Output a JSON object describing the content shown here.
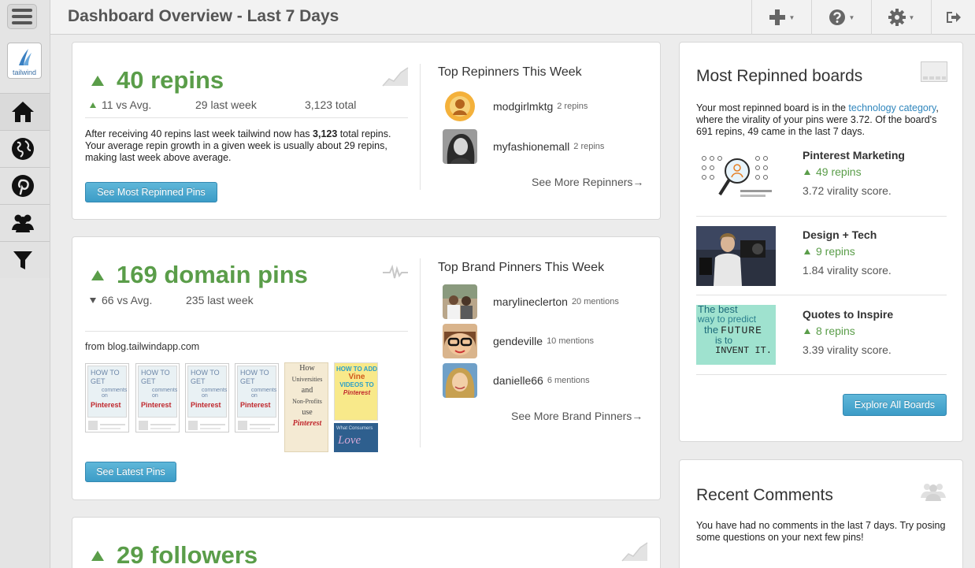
{
  "header": {
    "title": "Dashboard Overview - Last 7 Days"
  },
  "sidebar": {
    "logo_text": "tailwind",
    "items": [
      {
        "icon": "home-icon"
      },
      {
        "icon": "globe-icon"
      },
      {
        "icon": "pinterest-icon"
      },
      {
        "icon": "users-icon"
      },
      {
        "icon": "filter-icon"
      }
    ]
  },
  "repins_card": {
    "metric": "40 repins",
    "vs_avg": "11 vs Avg.",
    "last_week": "29 last week",
    "total": "3,123 total",
    "desc_pre": "After receiving 40 repins last week tailwind now has ",
    "desc_bold": "3,123",
    "desc_post": " total repins. Your average repin growth in a given week is usually about 29 repins, making last week above average.",
    "button": "See Most Repinned Pins",
    "top_title": "Top Repinners This Week",
    "top": [
      {
        "name": "modgirlmktg",
        "sub": "2 repins"
      },
      {
        "name": "myfashionemall",
        "sub": "2 repins"
      }
    ],
    "see_more": "See More Repinners→"
  },
  "domain_card": {
    "metric": "169 domain pins",
    "vs_avg": "66 vs Avg.",
    "last_week": "235 last week",
    "from": "from blog.tailwindapp.com",
    "pin_title_1": "HOW TO",
    "pin_title_2": "GET",
    "pin_title_3": "comments on",
    "pin_brand": "Pinterest",
    "pin5_lines": [
      "How",
      "Universities",
      "and",
      "Non-Profits",
      "use",
      "Pinterest"
    ],
    "pin6_lines": [
      "HOW TO ADD",
      "Vine",
      "VIDEOS TO",
      "Pinterest"
    ],
    "pin7_lines": [
      "What Consumers",
      "Love"
    ],
    "button": "See Latest Pins",
    "top_title": "Top Brand Pinners This Week",
    "top": [
      {
        "name": "marylineclerton",
        "sub": "20 mentions"
      },
      {
        "name": "gendeville",
        "sub": "10 mentions"
      },
      {
        "name": "danielle66",
        "sub": "6 mentions"
      }
    ],
    "see_more": "See More Brand Pinners→"
  },
  "followers_card": {
    "metric": "29 followers"
  },
  "boards_card": {
    "title": "Most Repinned boards",
    "desc_pre": "Your most repinned board is in the ",
    "desc_link": "technology category",
    "desc_post": ", where the virality of your pins were 3.72. Of the board's 691 repins, 49 came in the last 7 days.",
    "boards": [
      {
        "name": "Pinterest Marketing",
        "repins": "49 repins",
        "score": "3.72 virality score."
      },
      {
        "name": "Design + Tech",
        "repins": "9 repins",
        "score": "1.84 virality score."
      },
      {
        "name": "Quotes to Inspire",
        "repins": "8 repins",
        "score": "3.39 virality score."
      }
    ],
    "quote_lines": [
      "The best",
      "way to predict",
      "the",
      "FUTURE",
      "is to",
      "INVENT IT."
    ],
    "button": "Explore All Boards"
  },
  "comments_card": {
    "title": "Recent Comments",
    "text": "You have had no comments in the last 7 days. Try posing some questions on your next few pins!"
  },
  "colors": {
    "accent_green": "#5a9d49",
    "button_blue": "#3c9cc7",
    "link_blue": "#2f86bd"
  }
}
